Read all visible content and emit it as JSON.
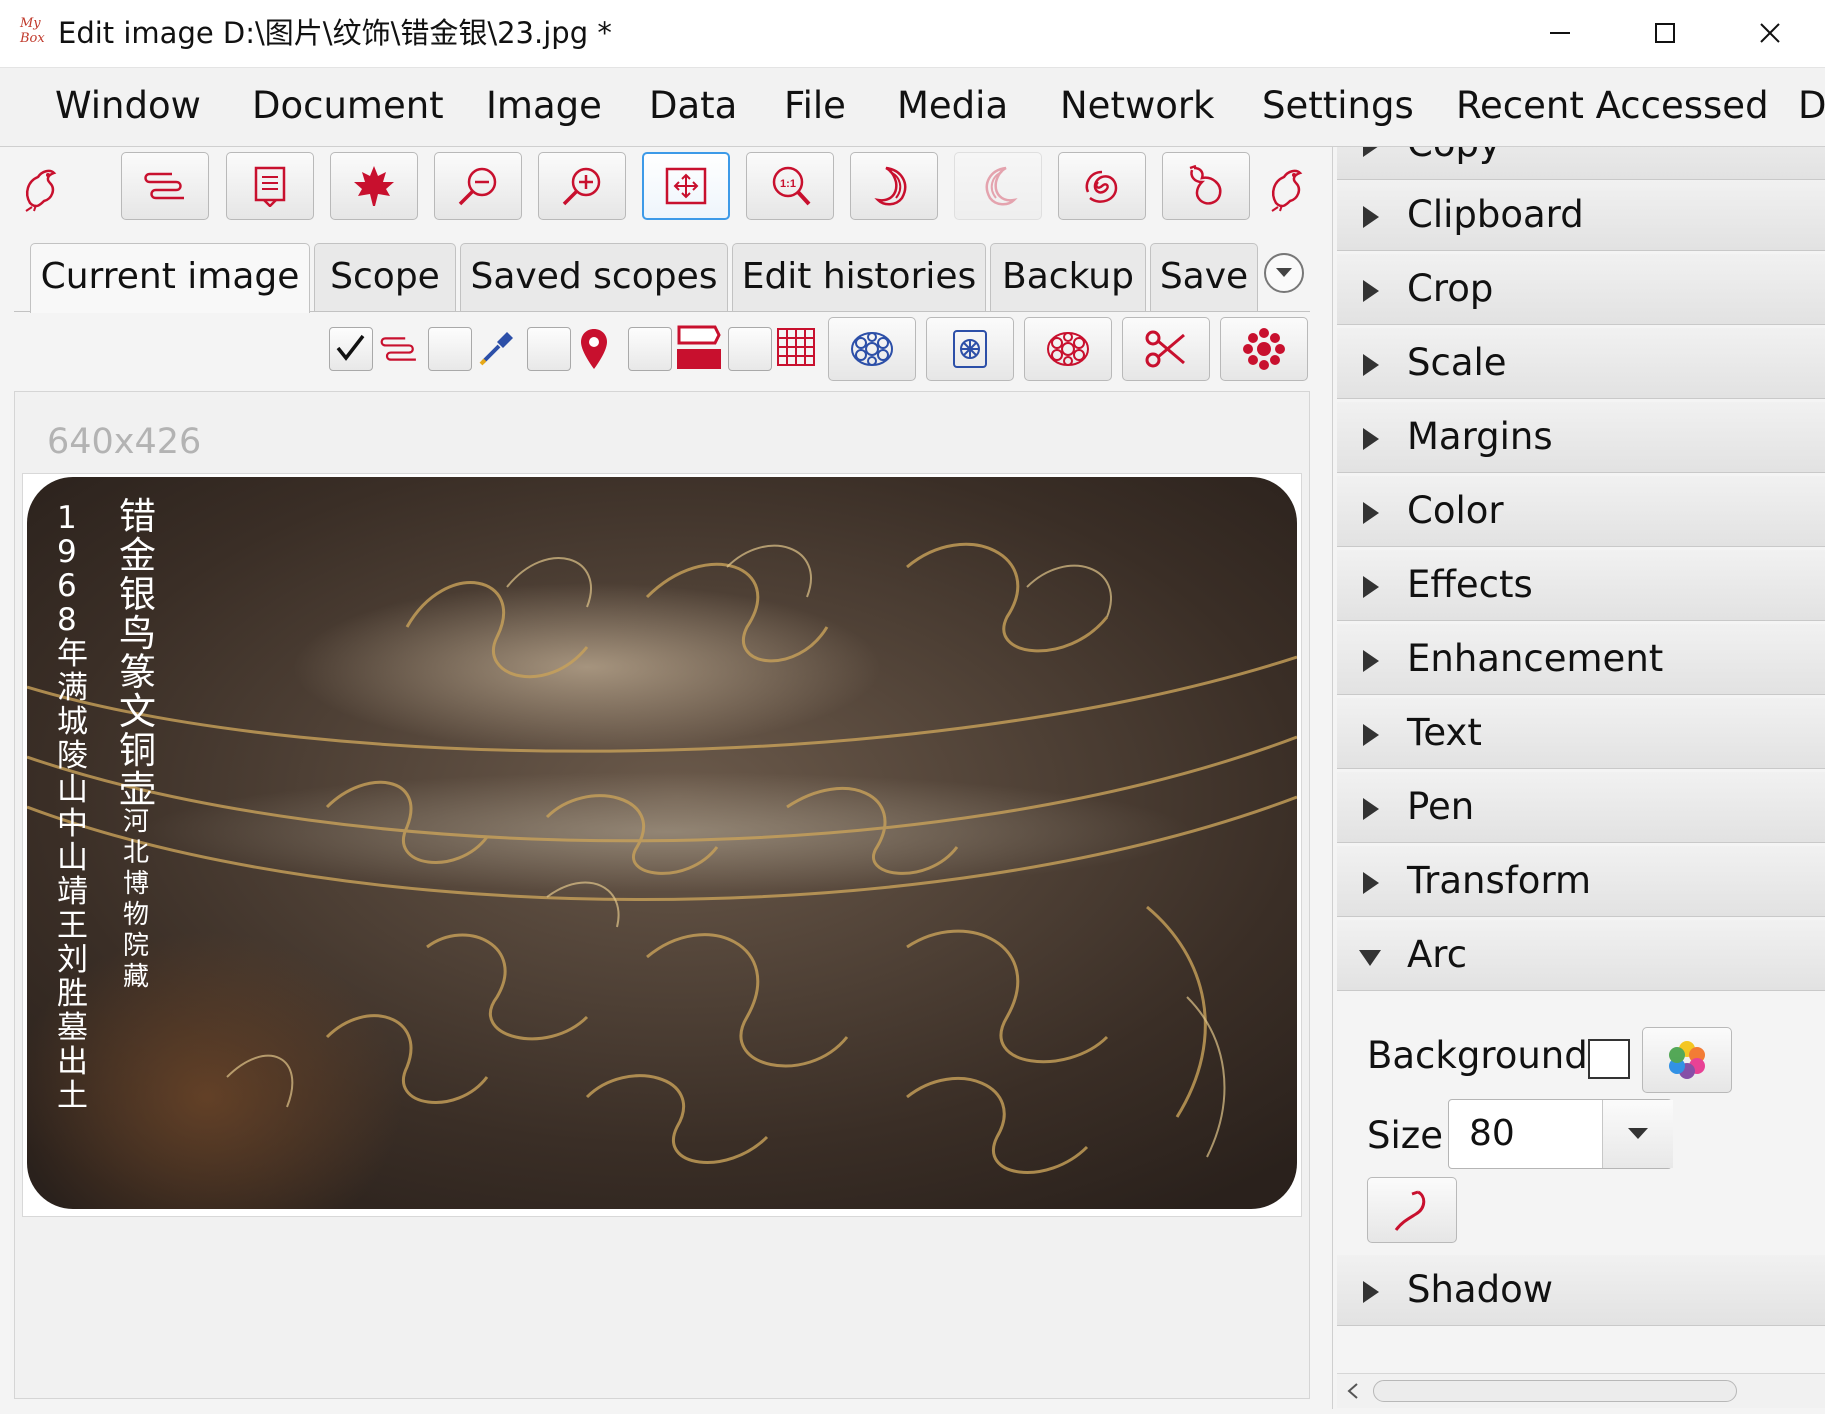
{
  "window": {
    "logo_text": "My Box",
    "title": "Edit image D:\\图片\\纹饰\\错金银\\23.jpg  *",
    "controls": [
      "minimize",
      "maximize",
      "close"
    ]
  },
  "menu": [
    "Window",
    "Document",
    "Image",
    "Data",
    "File",
    "Media",
    "Network",
    "Settings",
    "Recent Accessed",
    "D"
  ],
  "toolbar": {
    "icons": [
      "bird-icon",
      "options-icon",
      "document-icon",
      "maple-leaf-icon",
      "zoom-out-icon",
      "zoom-in-icon",
      "fit-window-icon",
      "actual-size-icon",
      "rotate-right-icon",
      "rotate-left-icon",
      "swirl-icon",
      "gourd-icon",
      "bird-icon"
    ]
  },
  "tabs": [
    "Current image",
    "Scope",
    "Saved scopes",
    "Edit histories",
    "Backup",
    "Save"
  ],
  "scope_tools": [
    "options-icon",
    "color-picker-icon",
    "location-pin-icon",
    "eraser-icon",
    "grid-icon",
    "pattern-icon",
    "frame-pattern-icon",
    "flower-outline-icon",
    "scissors-icon",
    "flower-filled-icon"
  ],
  "image": {
    "size_label": "640x426",
    "overlay_col1": "错金银鸟篆文铜壶",
    "overlay_col2": "1968年满城陵山中山靖王刘胜墓出土",
    "overlay_col3": "河北博物院藏"
  },
  "panel": {
    "sections": [
      "Copy",
      "Clipboard",
      "Crop",
      "Scale",
      "Margins",
      "Color",
      "Effects",
      "Enhancement",
      "Text",
      "Pen",
      "Transform",
      "Arc",
      "Shadow"
    ],
    "expanded": "Arc",
    "arc": {
      "background_label": "Background",
      "size_label": "Size",
      "size_value": "80"
    }
  },
  "colors": {
    "accent": "#c8102e",
    "icon_blue": "#2c4fa8",
    "selection": "#3d9ae8"
  }
}
